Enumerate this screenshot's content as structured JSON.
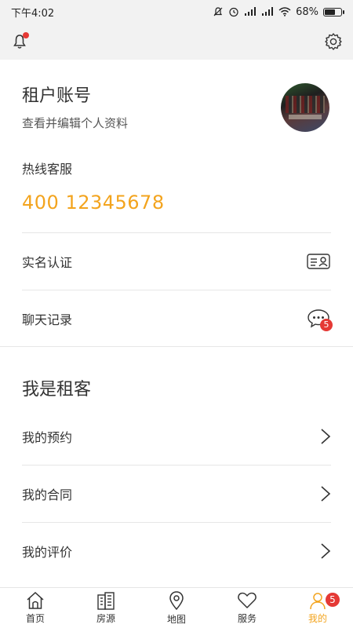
{
  "status_bar": {
    "time": "下午4:02",
    "battery_text": "68%",
    "battery_level": 0.68,
    "icons": [
      "mute-icon",
      "alarm-icon",
      "signal-icon",
      "signal-icon",
      "wifi-icon",
      "battery-icon"
    ]
  },
  "top_bar": {
    "notification_icon": "bell-icon",
    "settings_icon": "gear-icon"
  },
  "profile": {
    "name": "租户账号",
    "subtitle": "查看并编辑个人资料"
  },
  "hotline": {
    "label": "热线客服",
    "number": "400 12345678"
  },
  "menu_top": [
    {
      "label": "实名认证",
      "icon": "id-card-icon"
    },
    {
      "label": "聊天记录",
      "icon": "chat-icon",
      "badge": "5"
    }
  ],
  "tenant_section": {
    "title": "我是租客",
    "items": [
      {
        "label": "我的预约"
      },
      {
        "label": "我的合同"
      },
      {
        "label": "我的评价"
      }
    ]
  },
  "tabbar": {
    "items": [
      {
        "label": "首页",
        "icon": "home-icon"
      },
      {
        "label": "房源",
        "icon": "building-icon"
      },
      {
        "label": "地图",
        "icon": "map-pin-icon"
      },
      {
        "label": "服务",
        "icon": "heart-icon"
      },
      {
        "label": "我的",
        "icon": "user-icon",
        "badge": "5",
        "active": true
      }
    ]
  },
  "colors": {
    "accent": "#f3a41e",
    "badge": "#e53935",
    "divider": "#e6e6e6"
  }
}
